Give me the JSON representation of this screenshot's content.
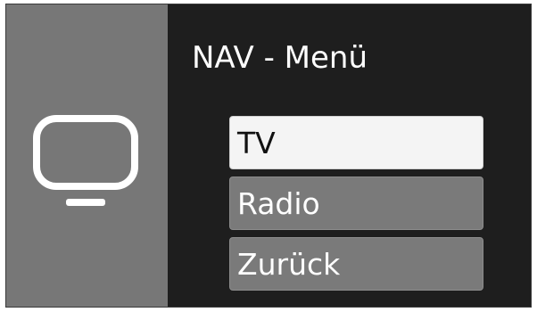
{
  "menu": {
    "title": "NAV - Menü",
    "items": [
      {
        "label": "TV",
        "selected": true
      },
      {
        "label": "Radio",
        "selected": false
      },
      {
        "label": "Zurück",
        "selected": false
      }
    ]
  },
  "icon": {
    "name": "tv-icon"
  },
  "colors": {
    "background": "#1e1e1e",
    "side_panel": "#777777",
    "item": "#7a7a7a",
    "item_selected": "#f4f4f4",
    "text": "#ffffff",
    "text_selected": "#111111"
  }
}
